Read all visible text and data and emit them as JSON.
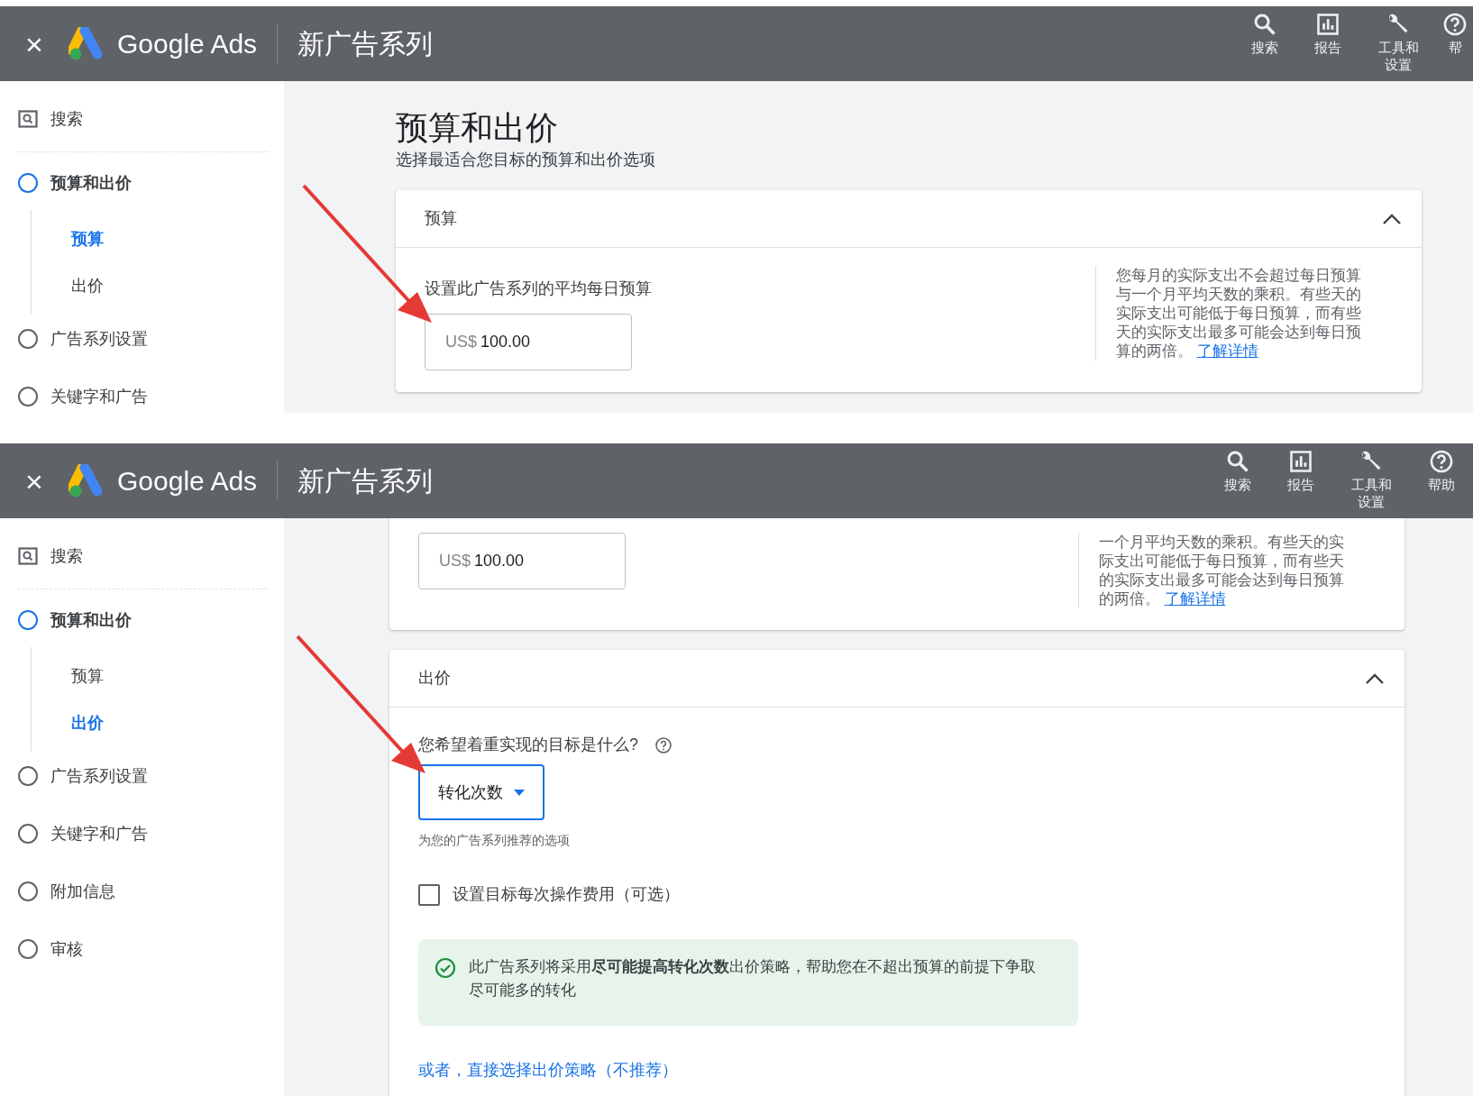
{
  "panels": [
    {
      "header": {
        "close": "×",
        "product": "Google Ads",
        "campaign": "新广告系列",
        "actions": [
          {
            "label": "搜索",
            "kind": "search"
          },
          {
            "label": "报告",
            "kind": "report"
          },
          {
            "label": "工具和设置",
            "kind": "tools"
          },
          {
            "label": "帮",
            "kind": "help"
          }
        ]
      },
      "sidebar": {
        "search": "搜索",
        "steps": [
          {
            "label": "预算和出价",
            "current": true,
            "children": [
              {
                "label": "预算",
                "selected": true
              },
              {
                "label": "出价",
                "selected": false
              }
            ]
          },
          {
            "label": "广告系列设置",
            "current": false
          },
          {
            "label": "关键字和广告",
            "current": false
          }
        ]
      },
      "content": {
        "title": "预算和出价",
        "subtitle": "选择最适合您目标的预算和出价选项",
        "sections": [
          {
            "kind": "budget",
            "heading": "预算",
            "expanded": true,
            "label": "设置此广告系列的平均每日预算",
            "currency": "US$",
            "amount": "100.00",
            "pointer": true,
            "help": "您每月的实际支出不会超过每日预算与一个月平均天数的乘积。有些天的实际支出可能低于每日预算，而有些天的实际支出最多可能会达到每日预算的两倍。",
            "help_link": "了解详情"
          }
        ]
      }
    },
    {
      "header": {
        "close": "×",
        "product": "Google Ads",
        "campaign": "新广告系列",
        "actions": [
          {
            "label": "搜索",
            "kind": "search"
          },
          {
            "label": "报告",
            "kind": "report"
          },
          {
            "label": "工具和设置",
            "kind": "tools"
          },
          {
            "label": "帮助",
            "kind": "help"
          }
        ]
      },
      "sidebar": {
        "search": "搜索",
        "steps": [
          {
            "label": "预算和出价",
            "current": true,
            "children": [
              {
                "label": "预算",
                "selected": false
              },
              {
                "label": "出价",
                "selected": true
              }
            ]
          },
          {
            "label": "广告系列设置",
            "current": false
          },
          {
            "label": "关键字和广告",
            "current": false
          },
          {
            "label": "附加信息",
            "current": false
          },
          {
            "label": "审核",
            "current": false
          }
        ]
      },
      "content": {
        "sections": [
          {
            "kind": "budget",
            "currency": "US$",
            "amount": "100.00",
            "pointer": false,
            "help": "一个月平均天数的乘积。有些天的实际支出可能低于每日预算，而有些天的实际支出最多可能会达到每日预算的两倍。",
            "help_link": "了解详情"
          },
          {
            "kind": "bidding",
            "heading": "出价",
            "expanded": true,
            "question": "您希望着重实现的目标是什么?",
            "goal": "转化次数",
            "pointer": true,
            "goal_hint": "为您的广告系列推荐的选项",
            "target_cpa": {
              "label": "设置目标每次操作费用（可选）",
              "checked": false
            },
            "notice": "此广告系列将采用**尽可能提高转化次数**出价策略，帮助您在不超出预算的前提下争取尽可能多的转化",
            "alt_link": "或者，直接选择出价策略（不推荐）"
          }
        ]
      }
    }
  ]
}
